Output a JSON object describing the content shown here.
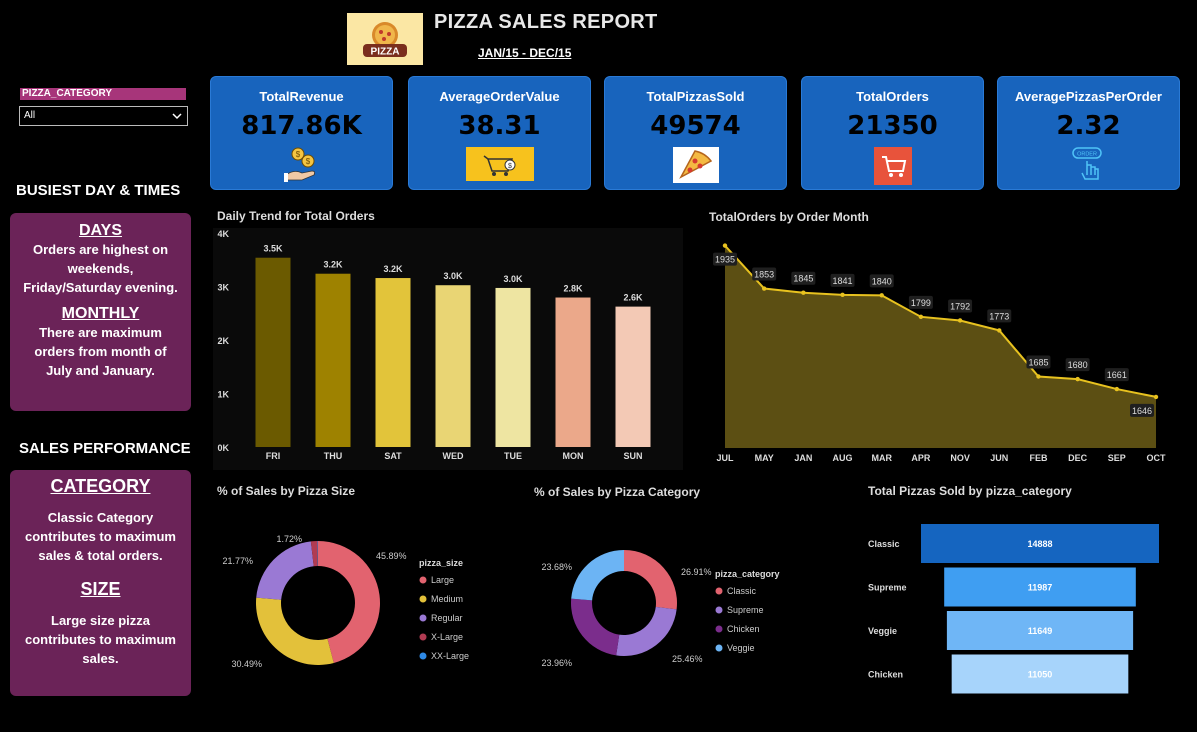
{
  "header": {
    "title": "PIZZA SALES REPORT",
    "subtitle": "JAN/15 - DEC/15",
    "logo_text": "PIZZA"
  },
  "slicer": {
    "label": "PIZZA_CATEGORY",
    "value": "All"
  },
  "kpis": [
    {
      "label": "TotalRevenue",
      "value": "817.86K",
      "icon": "money-hand-icon"
    },
    {
      "label": "AverageOrderValue",
      "value": "38.31",
      "icon": "basket-icon"
    },
    {
      "label": "TotalPizzasSold",
      "value": "49574",
      "icon": "pizza-slice-icon"
    },
    {
      "label": "TotalOrders",
      "value": "21350",
      "icon": "cart-icon"
    },
    {
      "label": "AveragePizzasPerOrder",
      "value": "2.32",
      "icon": "order-click-icon"
    }
  ],
  "busiest": {
    "heading": "BUSIEST DAY & TIMES",
    "days_title": "DAYS",
    "days_lines": [
      "Orders are highest on",
      "weekends,",
      "Friday/Saturday evening."
    ],
    "monthly_title": "MONTHLY",
    "monthly_lines": [
      "There are maximum",
      "orders from month of",
      "July and January."
    ]
  },
  "performance": {
    "heading": "SALES  PERFORMANCE",
    "category_title": "CATEGORY",
    "category_lines": [
      "Classic Category",
      "contributes to maximum",
      "sales & total orders."
    ],
    "size_title": "SIZE",
    "size_lines": [
      "Large size pizza",
      "contributes to maximum",
      "sales."
    ]
  },
  "colors": {
    "kpi_bg": "#1864bd",
    "panel_bg": "#6b2358",
    "slicer_label_bg": "#a7357a",
    "line_color": "#e8c21f",
    "area_fill": "#5c4f13"
  },
  "chart_data": [
    {
      "type": "bar",
      "title": "Daily Trend for Total Orders",
      "categories": [
        "FRI",
        "THU",
        "SAT",
        "WED",
        "TUE",
        "MON",
        "SUN"
      ],
      "values": [
        3538,
        3239,
        3158,
        3024,
        2973,
        2794,
        2624
      ],
      "data_labels": [
        "3.5K",
        "3.2K",
        "3.2K",
        "3.0K",
        "3.0K",
        "2.8K",
        "2.6K"
      ],
      "ylim": [
        0,
        4000
      ],
      "yticks": [
        "0K",
        "1K",
        "2K",
        "3K",
        "4K"
      ],
      "colors": [
        "#6b5a00",
        "#9e8200",
        "#e2c43a",
        "#e9d574",
        "#eee5a2",
        "#eba88a",
        "#f3c9b5"
      ]
    },
    {
      "type": "area",
      "title": "TotalOrders by Order Month",
      "categories": [
        "JUL",
        "MAY",
        "JAN",
        "AUG",
        "MAR",
        "APR",
        "NOV",
        "JUN",
        "FEB",
        "DEC",
        "SEP",
        "OCT"
      ],
      "values": [
        1935,
        1853,
        1845,
        1841,
        1840,
        1799,
        1792,
        1773,
        1685,
        1680,
        1661,
        1646
      ],
      "ylim": [
        1600,
        1940
      ]
    },
    {
      "type": "pie",
      "title": "% of Sales by Pizza Size",
      "legend_title": "pizza_size",
      "labels": [
        "Large",
        "Medium",
        "Regular",
        "X-Large",
        "XX-Large"
      ],
      "values": [
        45.89,
        30.49,
        21.77,
        1.72,
        0.12
      ],
      "value_labels": [
        "45.89%",
        "30.49%",
        "21.77%",
        "1.72%",
        ""
      ],
      "colors": [
        "#e2636f",
        "#e3c13a",
        "#9a79d4",
        "#b13b52",
        "#2e8ae6"
      ]
    },
    {
      "type": "pie",
      "title": "% of Sales by Pizza Category",
      "legend_title": "pizza_category",
      "labels": [
        "Classic",
        "Supreme",
        "Chicken",
        "Veggie"
      ],
      "values": [
        26.91,
        25.46,
        23.96,
        23.68
      ],
      "value_labels": [
        "26.91%",
        "25.46%",
        "23.96%",
        "23.68%"
      ],
      "colors": [
        "#e2636f",
        "#9a79d4",
        "#7b2d8c",
        "#6cb4f4"
      ]
    },
    {
      "type": "bar",
      "title": "Total Pizzas Sold by pizza_category",
      "orientation": "horizontal",
      "categories": [
        "Classic",
        "Supreme",
        "Veggie",
        "Chicken"
      ],
      "values": [
        14888,
        11987,
        11649,
        11050
      ],
      "colors": [
        "#1565c0",
        "#3f9ef2",
        "#6fb6f6",
        "#a7d4fb"
      ]
    }
  ]
}
